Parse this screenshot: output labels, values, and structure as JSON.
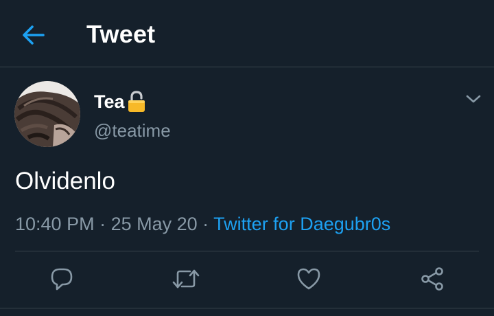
{
  "header": {
    "title": "Tweet",
    "back_icon": "arrow-left-icon"
  },
  "tweet": {
    "author": {
      "display_name": "Tea",
      "handle": "@teatime",
      "lock_icon": "lock-icon"
    },
    "text": "Olvidenlo",
    "time": "10:40 PM",
    "separator": " · ",
    "date": "25 May 20",
    "source": "Twitter for Daegubr0s"
  },
  "actions": [
    {
      "name": "reply-button",
      "icon": "reply-icon"
    },
    {
      "name": "retweet-button",
      "icon": "retweet-icon"
    },
    {
      "name": "like-button",
      "icon": "heart-icon"
    },
    {
      "name": "share-button",
      "icon": "share-icon"
    }
  ],
  "colors": {
    "background": "#15202b",
    "accent": "#1da1f2",
    "secondary_text": "#8899a6",
    "border": "#38444d"
  }
}
